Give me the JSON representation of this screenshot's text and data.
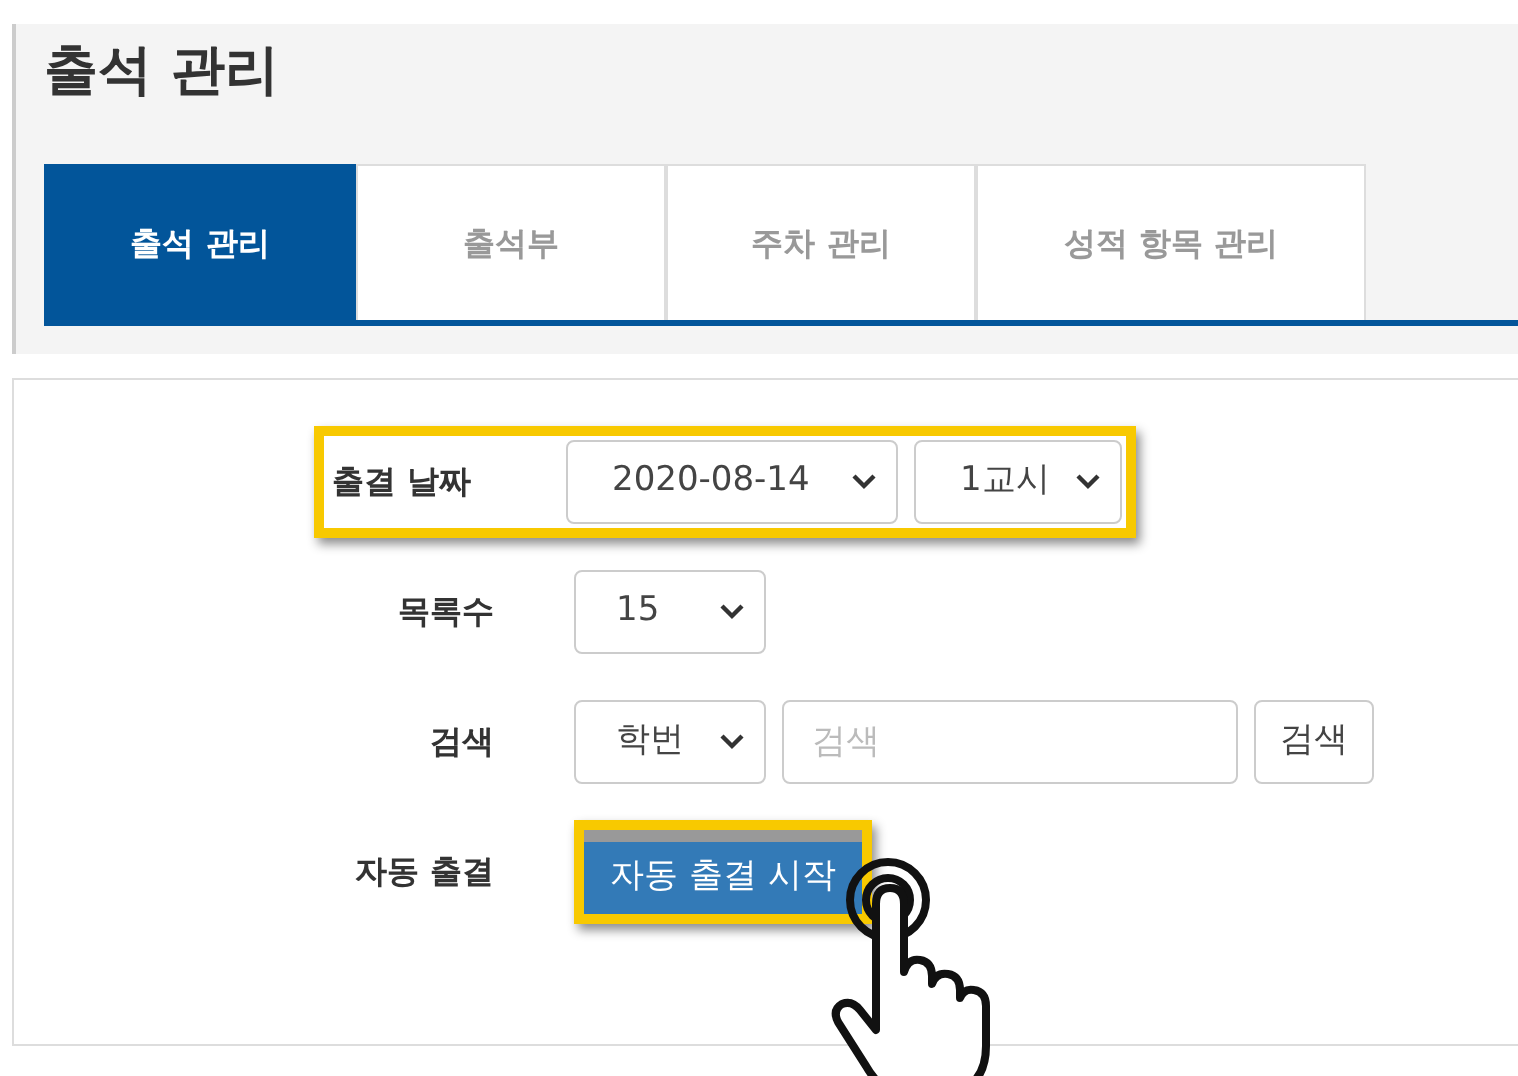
{
  "page_title": "출석 관리",
  "tabs": [
    {
      "label": "출석 관리",
      "selected": true
    },
    {
      "label": "출석부",
      "selected": false
    },
    {
      "label": "주차 관리",
      "selected": false
    },
    {
      "label": "성적 항목 관리",
      "selected": false
    }
  ],
  "form": {
    "rows": [
      {
        "label": "출결 날짜",
        "highlighted": true,
        "controls": [
          {
            "kind": "select",
            "value": "2020-08-14",
            "highlighted": false
          },
          {
            "kind": "select",
            "value": "1교시",
            "highlighted": false
          }
        ]
      },
      {
        "label": "목록수",
        "highlighted": false,
        "controls": [
          {
            "kind": "select",
            "value": "15",
            "highlighted": false
          }
        ]
      },
      {
        "label": "검색",
        "highlighted": false,
        "controls": [
          {
            "kind": "select",
            "value": "학번",
            "highlighted": false
          },
          {
            "kind": "input",
            "placeholder": "검색",
            "highlighted": false
          },
          {
            "kind": "button",
            "label": "검색",
            "highlighted": false
          }
        ]
      },
      {
        "label": "자동 출결",
        "highlighted": false,
        "controls": [
          {
            "kind": "primary_button",
            "label": "자동 출결 시작",
            "highlighted": true
          }
        ]
      }
    ]
  }
}
